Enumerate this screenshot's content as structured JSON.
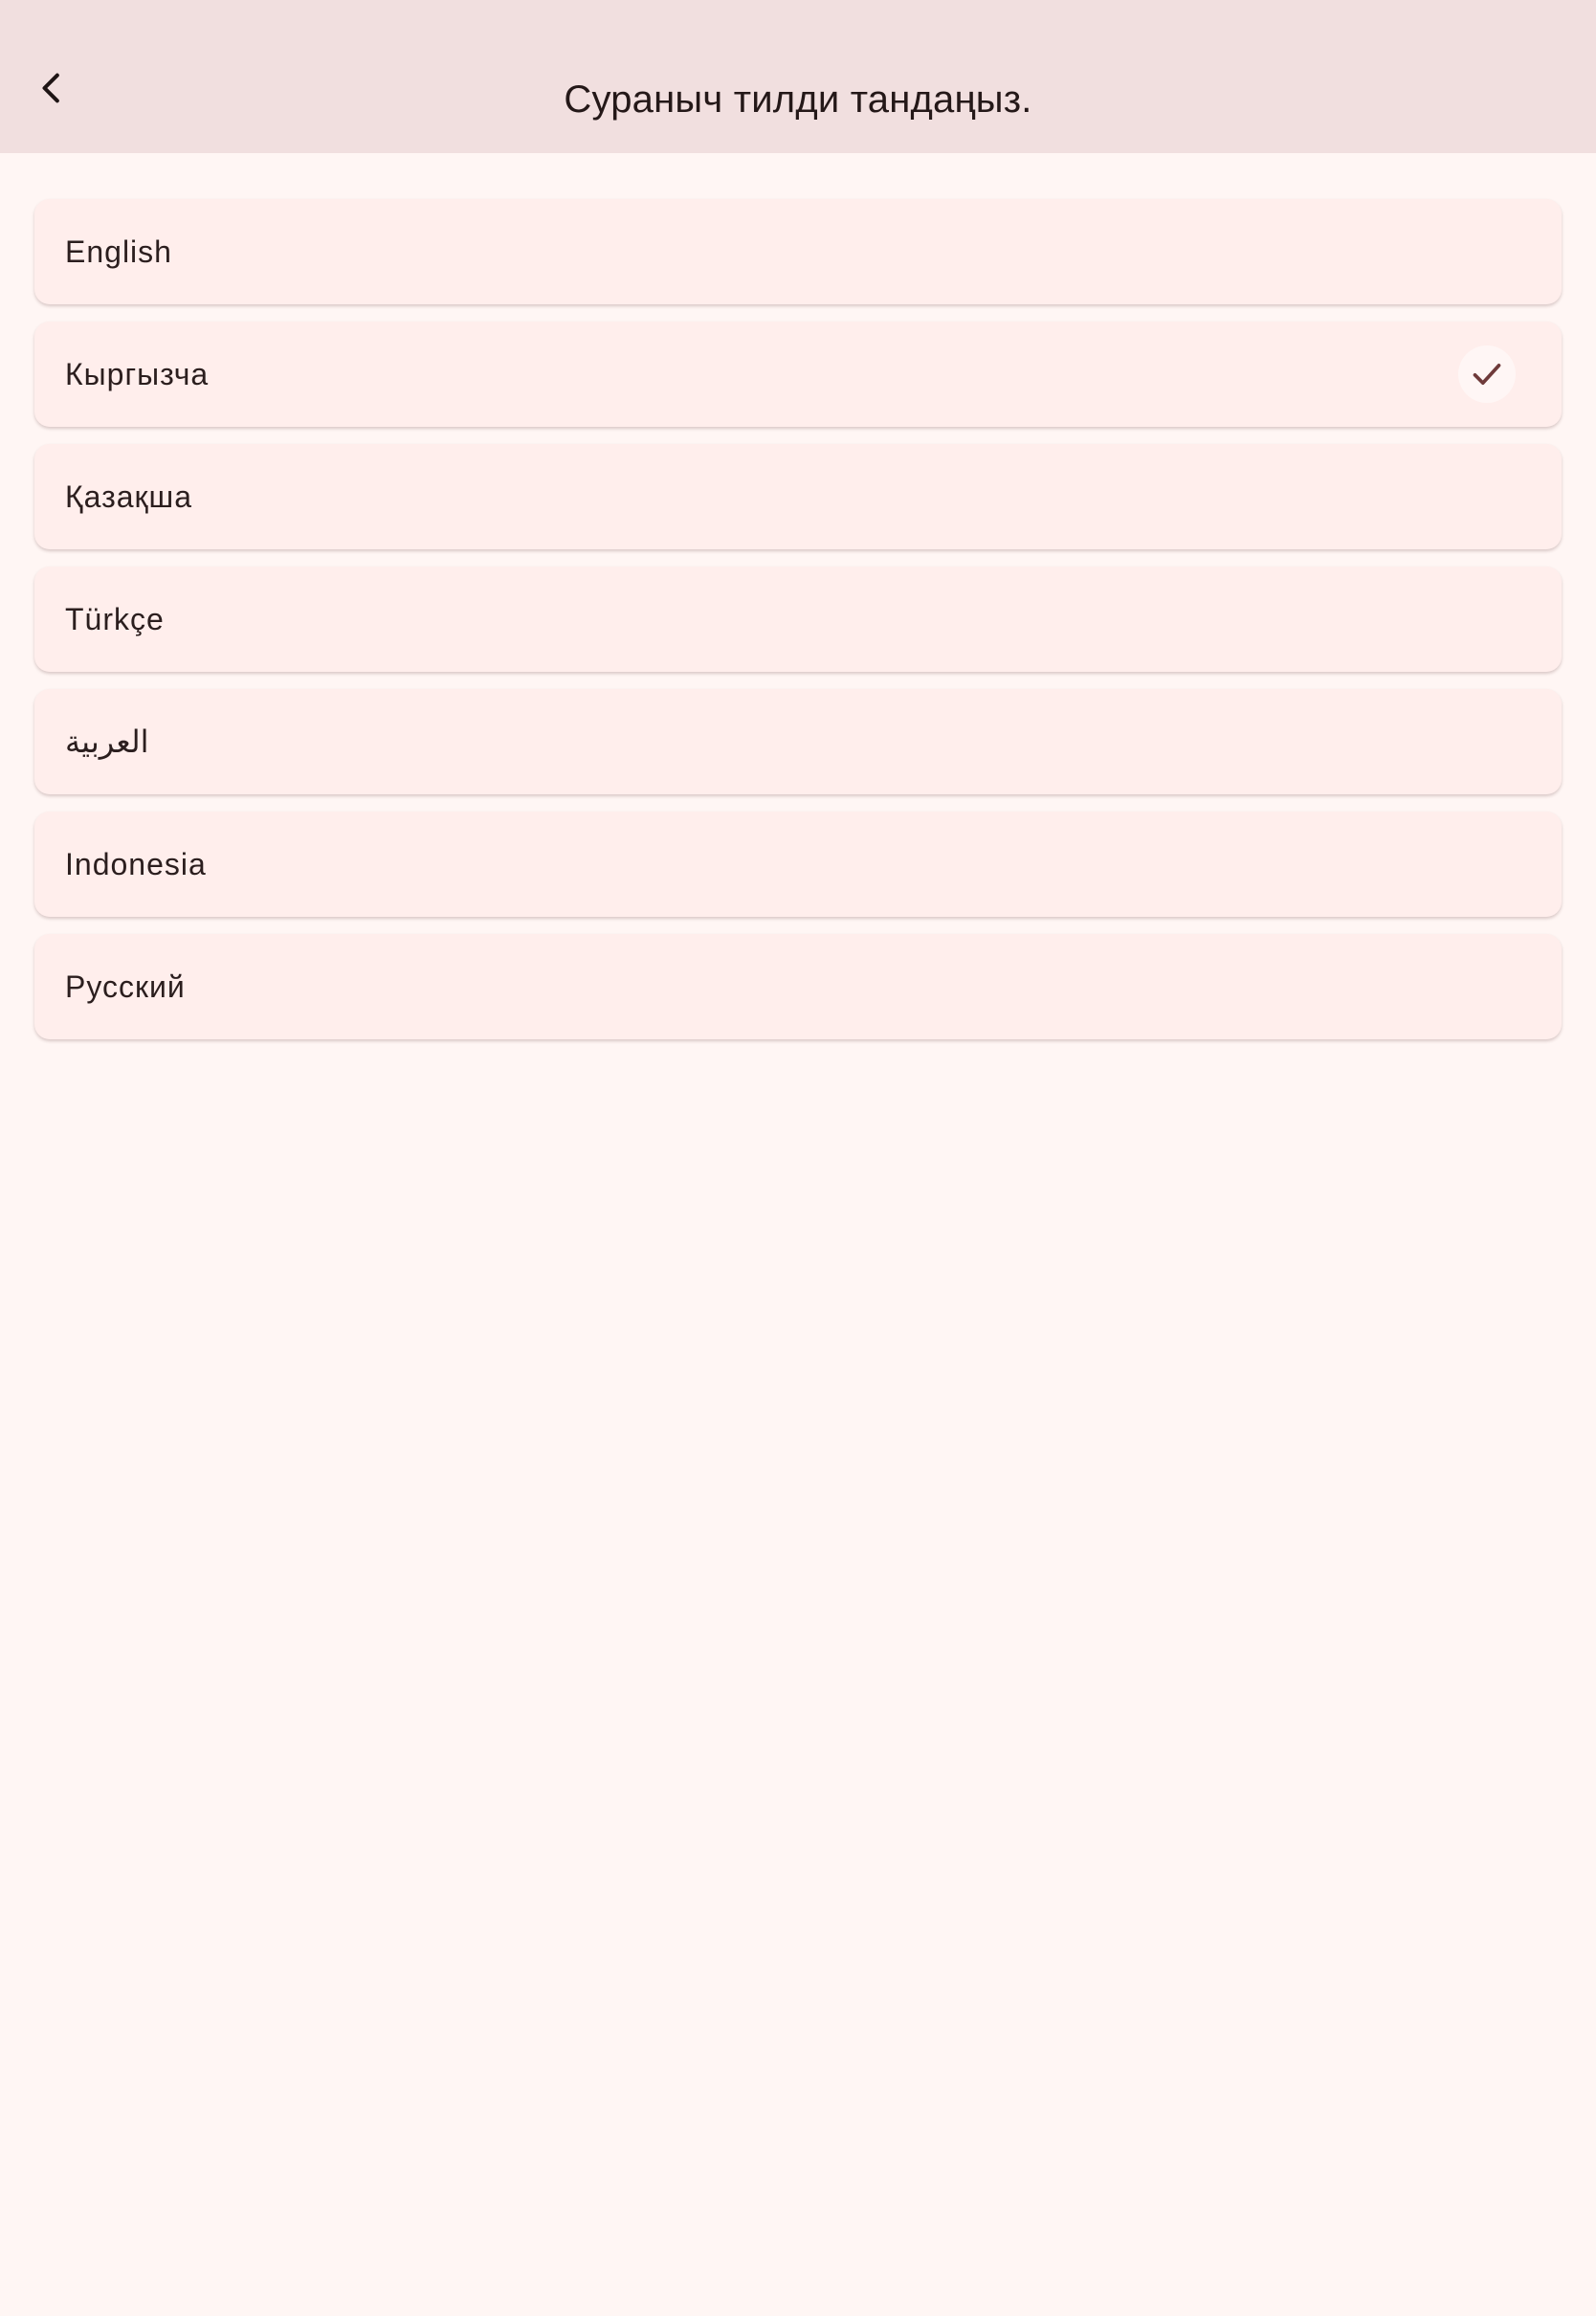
{
  "header": {
    "title": "Сураныч тилди тандаңыз.",
    "back_icon": "chevron-left-icon"
  },
  "languages": [
    {
      "label": "English",
      "selected": false
    },
    {
      "label": "Кыргызча",
      "selected": true
    },
    {
      "label": "Қазақша",
      "selected": false
    },
    {
      "label": "Türkçe",
      "selected": false
    },
    {
      "label": "العربية",
      "selected": false
    },
    {
      "label": "Indonesia",
      "selected": false
    },
    {
      "label": "Русский",
      "selected": false
    }
  ],
  "colors": {
    "app_bar": "#f1dfdf",
    "background": "#fff6f4",
    "item": "#ffeeec",
    "check": "#6f3a3a"
  }
}
